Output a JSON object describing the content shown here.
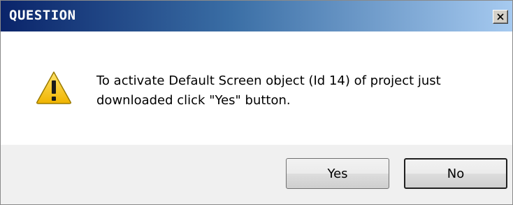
{
  "dialog": {
    "title": "QUESTION",
    "message": "To activate Default Screen object (Id 14) of project just downloaded click \"Yes\" button.",
    "icon": "warning-icon",
    "buttons": {
      "yes_label": "Yes",
      "no_label": "No",
      "default_button": "no"
    },
    "colors": {
      "titlebar_start": "#0a246a",
      "titlebar_end": "#a6caf0",
      "title_text": "#ffffff",
      "warning_fill": "#f5c518"
    }
  }
}
